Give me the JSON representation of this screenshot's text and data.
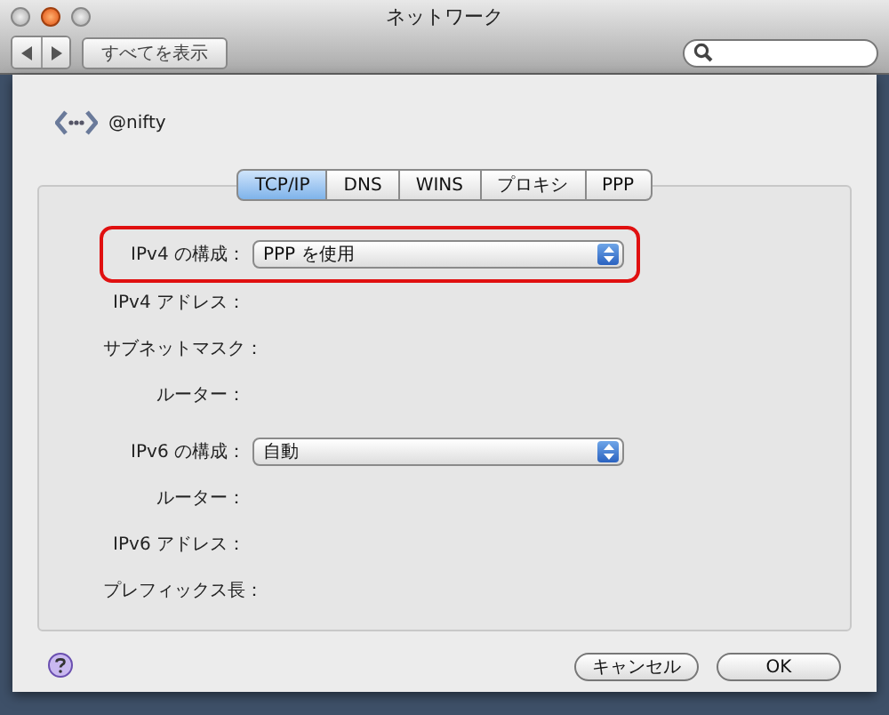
{
  "window": {
    "title": "ネットワーク"
  },
  "toolbar": {
    "show_all_button": "すべてを表示"
  },
  "service": {
    "name": "@nifty"
  },
  "tabs": [
    {
      "label": "TCP/IP",
      "selected": true
    },
    {
      "label": "DNS",
      "selected": false
    },
    {
      "label": "WINS",
      "selected": false
    },
    {
      "label": "プロキシ",
      "selected": false
    },
    {
      "label": "PPP",
      "selected": false
    }
  ],
  "fields": [
    {
      "kind": "popup",
      "label": "IPv4 の構成：",
      "value": "PPP を使用",
      "highlighted": true
    },
    {
      "kind": "text",
      "label": "IPv4 アドレス：",
      "highlighted": false
    },
    {
      "kind": "text",
      "label": "サブネットマスク：",
      "highlighted": false
    },
    {
      "kind": "text",
      "label": "ルーター：",
      "highlighted": false
    },
    {
      "kind": "popup",
      "label": "IPv6 の構成：",
      "value": "自動",
      "highlighted": false
    },
    {
      "kind": "text",
      "label": "ルーター：",
      "highlighted": false
    },
    {
      "kind": "text",
      "label": "IPv6 アドレス：",
      "highlighted": false
    },
    {
      "kind": "text",
      "label": "プレフィックス長：",
      "highlighted": false
    }
  ],
  "buttons": [
    {
      "label": "キャンセル"
    },
    {
      "label": "OK"
    }
  ]
}
